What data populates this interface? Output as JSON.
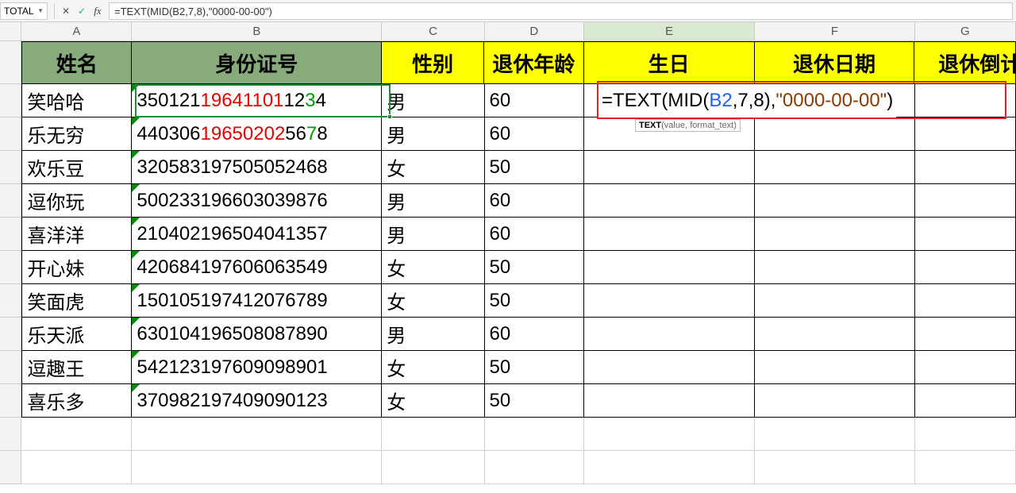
{
  "formula_bar": {
    "name_box": "TOTAL",
    "formula": "=TEXT(MID(B2,7,8),\"0000-00-00\")"
  },
  "columns": [
    "A",
    "B",
    "C",
    "D",
    "E",
    "F",
    "G"
  ],
  "headers": {
    "A": "姓名",
    "B": "身份证号",
    "C": "性别",
    "D": "退休年龄",
    "E": "生日",
    "F": "退休日期",
    "G": "退休倒计"
  },
  "rows": [
    {
      "name": "笑哈哈",
      "id_pre": "350121",
      "id_red": "19641101",
      "id_post": "12",
      "id_sex": "3",
      "id_last": "4",
      "gender": "男",
      "age": "60"
    },
    {
      "name": "乐无穷",
      "id_pre": "440306",
      "id_red": "19650202",
      "id_post": "56",
      "id_sex": "7",
      "id_last": "8",
      "gender": "男",
      "age": "60"
    },
    {
      "name": "欢乐豆",
      "id_full": "320583197505052468",
      "gender": "女",
      "age": "50"
    },
    {
      "name": "逗你玩",
      "id_full": "500233196603039876",
      "gender": "男",
      "age": "60"
    },
    {
      "name": "喜洋洋",
      "id_full": "210402196504041357",
      "gender": "男",
      "age": "60"
    },
    {
      "name": "开心妹",
      "id_full": "420684197606063549",
      "gender": "女",
      "age": "50"
    },
    {
      "name": "笑面虎",
      "id_full": "150105197412076789",
      "gender": "女",
      "age": "50"
    },
    {
      "name": "乐天派",
      "id_full": "630104196508087890",
      "gender": "男",
      "age": "60"
    },
    {
      "name": "逗趣王",
      "id_full": "542123197609098901",
      "gender": "女",
      "age": "50"
    },
    {
      "name": "喜乐多",
      "id_full": "370982197409090123",
      "gender": "女",
      "age": "50"
    }
  ],
  "edit": {
    "prefix": "=TEXT(MID(",
    "ref": "B2",
    "args": ",7,8)",
    "sep": ",",
    "fmt": "\"0000-00-00\"",
    "suffix": ")"
  },
  "tooltip": {
    "bold": "TEXT",
    "rest": "(value, format_text)"
  }
}
